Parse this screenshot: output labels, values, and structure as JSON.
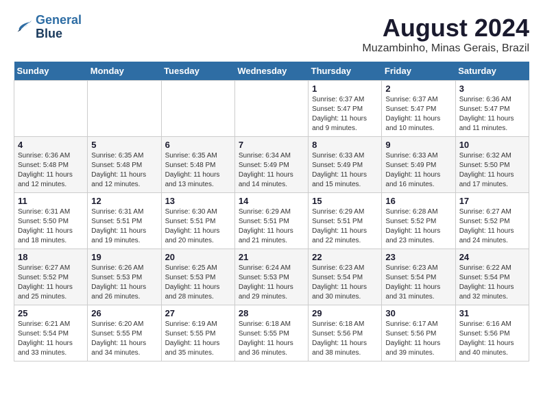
{
  "logo": {
    "line1": "General",
    "line2": "Blue"
  },
  "title": "August 2024",
  "location": "Muzambinho, Minas Gerais, Brazil",
  "days_of_week": [
    "Sunday",
    "Monday",
    "Tuesday",
    "Wednesday",
    "Thursday",
    "Friday",
    "Saturday"
  ],
  "weeks": [
    [
      {
        "day": "",
        "info": ""
      },
      {
        "day": "",
        "info": ""
      },
      {
        "day": "",
        "info": ""
      },
      {
        "day": "",
        "info": ""
      },
      {
        "day": "1",
        "info": "Sunrise: 6:37 AM\nSunset: 5:47 PM\nDaylight: 11 hours\nand 9 minutes."
      },
      {
        "day": "2",
        "info": "Sunrise: 6:37 AM\nSunset: 5:47 PM\nDaylight: 11 hours\nand 10 minutes."
      },
      {
        "day": "3",
        "info": "Sunrise: 6:36 AM\nSunset: 5:47 PM\nDaylight: 11 hours\nand 11 minutes."
      }
    ],
    [
      {
        "day": "4",
        "info": "Sunrise: 6:36 AM\nSunset: 5:48 PM\nDaylight: 11 hours\nand 12 minutes."
      },
      {
        "day": "5",
        "info": "Sunrise: 6:35 AM\nSunset: 5:48 PM\nDaylight: 11 hours\nand 12 minutes."
      },
      {
        "day": "6",
        "info": "Sunrise: 6:35 AM\nSunset: 5:48 PM\nDaylight: 11 hours\nand 13 minutes."
      },
      {
        "day": "7",
        "info": "Sunrise: 6:34 AM\nSunset: 5:49 PM\nDaylight: 11 hours\nand 14 minutes."
      },
      {
        "day": "8",
        "info": "Sunrise: 6:33 AM\nSunset: 5:49 PM\nDaylight: 11 hours\nand 15 minutes."
      },
      {
        "day": "9",
        "info": "Sunrise: 6:33 AM\nSunset: 5:49 PM\nDaylight: 11 hours\nand 16 minutes."
      },
      {
        "day": "10",
        "info": "Sunrise: 6:32 AM\nSunset: 5:50 PM\nDaylight: 11 hours\nand 17 minutes."
      }
    ],
    [
      {
        "day": "11",
        "info": "Sunrise: 6:31 AM\nSunset: 5:50 PM\nDaylight: 11 hours\nand 18 minutes."
      },
      {
        "day": "12",
        "info": "Sunrise: 6:31 AM\nSunset: 5:51 PM\nDaylight: 11 hours\nand 19 minutes."
      },
      {
        "day": "13",
        "info": "Sunrise: 6:30 AM\nSunset: 5:51 PM\nDaylight: 11 hours\nand 20 minutes."
      },
      {
        "day": "14",
        "info": "Sunrise: 6:29 AM\nSunset: 5:51 PM\nDaylight: 11 hours\nand 21 minutes."
      },
      {
        "day": "15",
        "info": "Sunrise: 6:29 AM\nSunset: 5:51 PM\nDaylight: 11 hours\nand 22 minutes."
      },
      {
        "day": "16",
        "info": "Sunrise: 6:28 AM\nSunset: 5:52 PM\nDaylight: 11 hours\nand 23 minutes."
      },
      {
        "day": "17",
        "info": "Sunrise: 6:27 AM\nSunset: 5:52 PM\nDaylight: 11 hours\nand 24 minutes."
      }
    ],
    [
      {
        "day": "18",
        "info": "Sunrise: 6:27 AM\nSunset: 5:52 PM\nDaylight: 11 hours\nand 25 minutes."
      },
      {
        "day": "19",
        "info": "Sunrise: 6:26 AM\nSunset: 5:53 PM\nDaylight: 11 hours\nand 26 minutes."
      },
      {
        "day": "20",
        "info": "Sunrise: 6:25 AM\nSunset: 5:53 PM\nDaylight: 11 hours\nand 28 minutes."
      },
      {
        "day": "21",
        "info": "Sunrise: 6:24 AM\nSunset: 5:53 PM\nDaylight: 11 hours\nand 29 minutes."
      },
      {
        "day": "22",
        "info": "Sunrise: 6:23 AM\nSunset: 5:54 PM\nDaylight: 11 hours\nand 30 minutes."
      },
      {
        "day": "23",
        "info": "Sunrise: 6:23 AM\nSunset: 5:54 PM\nDaylight: 11 hours\nand 31 minutes."
      },
      {
        "day": "24",
        "info": "Sunrise: 6:22 AM\nSunset: 5:54 PM\nDaylight: 11 hours\nand 32 minutes."
      }
    ],
    [
      {
        "day": "25",
        "info": "Sunrise: 6:21 AM\nSunset: 5:54 PM\nDaylight: 11 hours\nand 33 minutes."
      },
      {
        "day": "26",
        "info": "Sunrise: 6:20 AM\nSunset: 5:55 PM\nDaylight: 11 hours\nand 34 minutes."
      },
      {
        "day": "27",
        "info": "Sunrise: 6:19 AM\nSunset: 5:55 PM\nDaylight: 11 hours\nand 35 minutes."
      },
      {
        "day": "28",
        "info": "Sunrise: 6:18 AM\nSunset: 5:55 PM\nDaylight: 11 hours\nand 36 minutes."
      },
      {
        "day": "29",
        "info": "Sunrise: 6:18 AM\nSunset: 5:56 PM\nDaylight: 11 hours\nand 38 minutes."
      },
      {
        "day": "30",
        "info": "Sunrise: 6:17 AM\nSunset: 5:56 PM\nDaylight: 11 hours\nand 39 minutes."
      },
      {
        "day": "31",
        "info": "Sunrise: 6:16 AM\nSunset: 5:56 PM\nDaylight: 11 hours\nand 40 minutes."
      }
    ]
  ]
}
